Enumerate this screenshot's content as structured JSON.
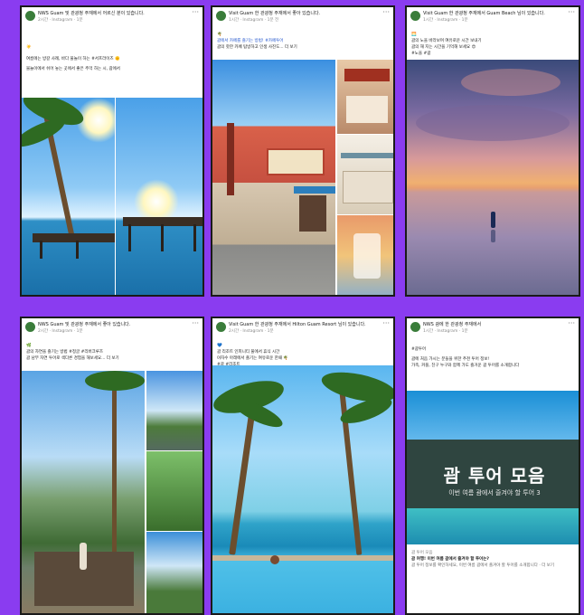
{
  "background_color": "#8a3cf0",
  "posts": [
    {
      "header_name": "NWS Guam 및 관광청 주재에서 어르신 분이 있습니다.",
      "header_sub": "2시간 · Instagram · 1분",
      "lines": [
        "☀️",
        "여름에는 방갈 사례, 바다 물놀이 하는 #서프라이즈 🌞",
        "물놀이에서 쉬어 놓는 곳에서 좋은 추억 하는 시, 괌에서"
      ]
    },
    {
      "header_name": "Visit Guam 한 관광청 주재에서 좋아 있습니다.",
      "header_sub": "1시간 · Instagram · 1분 전",
      "lines": [
        "🌴",
        "괌에서 카페를 즐기는 방법! #카페투어",
        "괌의 핫한 카페 탐방하고 인생 사진도... 더 보기"
      ]
    },
    {
      "header_name": "Visit Guam 한 관광청 주재에서 Guam Beach 님이 있습니다.",
      "header_sub": "1시간 · Instagram · 1분",
      "lines": [
        "🌅",
        "괌의 노을 바라보며 여유로운 시간 보내기",
        "괌의 해 지는 시간을 기억해 보세요 😍",
        "#노을 #괌"
      ]
    },
    {
      "header_name": "NWS Guam 및 관광청 주재에서 좋아 있습니다.",
      "header_sub": "2시간 · Instagram · 1분",
      "lines": [
        "🌿",
        "괌의 자연을 즐기는 방법 #정글 #리버크루즈",
        "괌 남부 자연 투어로 색다른 경험을 해보세요... 더 보기"
      ]
    },
    {
      "header_name": "Visit Guam 한 관광청 주재에서 Hilton Guam Resort 님이 있습니다.",
      "header_sub": "2시간 · Instagram · 1분",
      "lines": [
        "💙",
        "괌 리조트 인피니티 풀에서 휴식 시간",
        "야자수 아래에서 즐기는 여유로운 한때 🌴",
        "#괌 #리조트"
      ]
    },
    {
      "header_name": "NWS 괌에 한 관광청 주재에서",
      "header_sub": "1시간 · Instagram · 1분",
      "lines": [
        "#괌투어",
        "괌에 처음 가시는 분들을 위한 추천 투어 정보!",
        "가족, 커플, 친구 누구와 함께 가도 즐거운 괌 투어를 소개합니다"
      ],
      "banner_title": "괌 투어 모음",
      "banner_sub": "이번 여름 괌에서 즐겨야 할 투어 3",
      "footer_small": "괌 투어 모음",
      "footer_bold": "괌 여행! 이번 여름 괌에서 즐겨야 할 투어는?",
      "footer_line": "괌 투어 정보를 확인하세요, 이번 여름 괌에서 즐겨야 할 투어를 소개합니다 · 더 보기"
    }
  ]
}
